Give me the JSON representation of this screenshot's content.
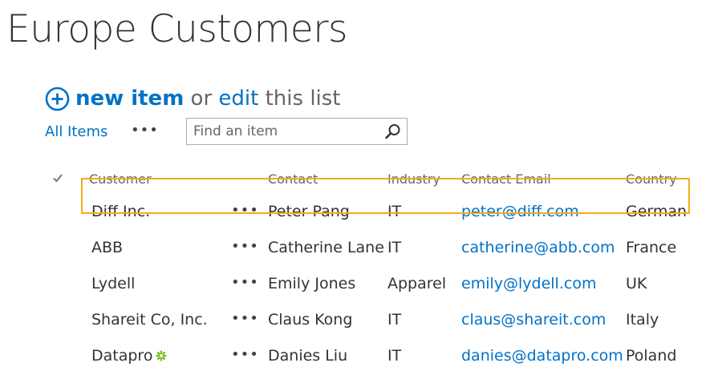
{
  "page": {
    "title": "Europe Customers"
  },
  "actions": {
    "new_item_label": "new item",
    "or_text": "or",
    "edit_label": "edit",
    "this_list_text": "this list"
  },
  "views": {
    "current_view": "All Items",
    "more_label": "•••"
  },
  "search": {
    "placeholder": "Find an item",
    "value": ""
  },
  "list": {
    "columns": [
      "Customer",
      "Contact",
      "Industry",
      "Contact Email",
      "Country"
    ],
    "row_menu_label": "•••",
    "rows": [
      {
        "customer": "Diff Inc.",
        "contact": "Peter Pang",
        "industry": "IT",
        "email": "peter@diff.com",
        "country": "German"
      },
      {
        "customer": "ABB",
        "contact": "Catherine Lane",
        "industry": "IT",
        "email": "catherine@abb.com",
        "country": "France"
      },
      {
        "customer": "Lydell",
        "contact": "Emily Jones",
        "industry": "Apparel",
        "email": "emily@lydell.com",
        "country": "UK"
      },
      {
        "customer": "Shareit Co, Inc.",
        "contact": "Claus Kong",
        "industry": "IT",
        "email": "claus@shareit.com",
        "country": "Italy"
      },
      {
        "customer": "Datapro",
        "contact": "Danies Liu",
        "industry": "IT",
        "email": "danies@datapro.com",
        "country": "Poland",
        "is_new": true
      }
    ]
  },
  "colors": {
    "link": "#0072c6",
    "title_text": "#333333",
    "muted_text": "#666666",
    "highlight_border": "#f0ad1c",
    "new_badge": "#6bb700"
  },
  "icons": {
    "add": "plus-circle-icon",
    "search": "search-icon",
    "select_all": "checkmark-icon",
    "new_item_badge": "new-item-badge-icon"
  }
}
